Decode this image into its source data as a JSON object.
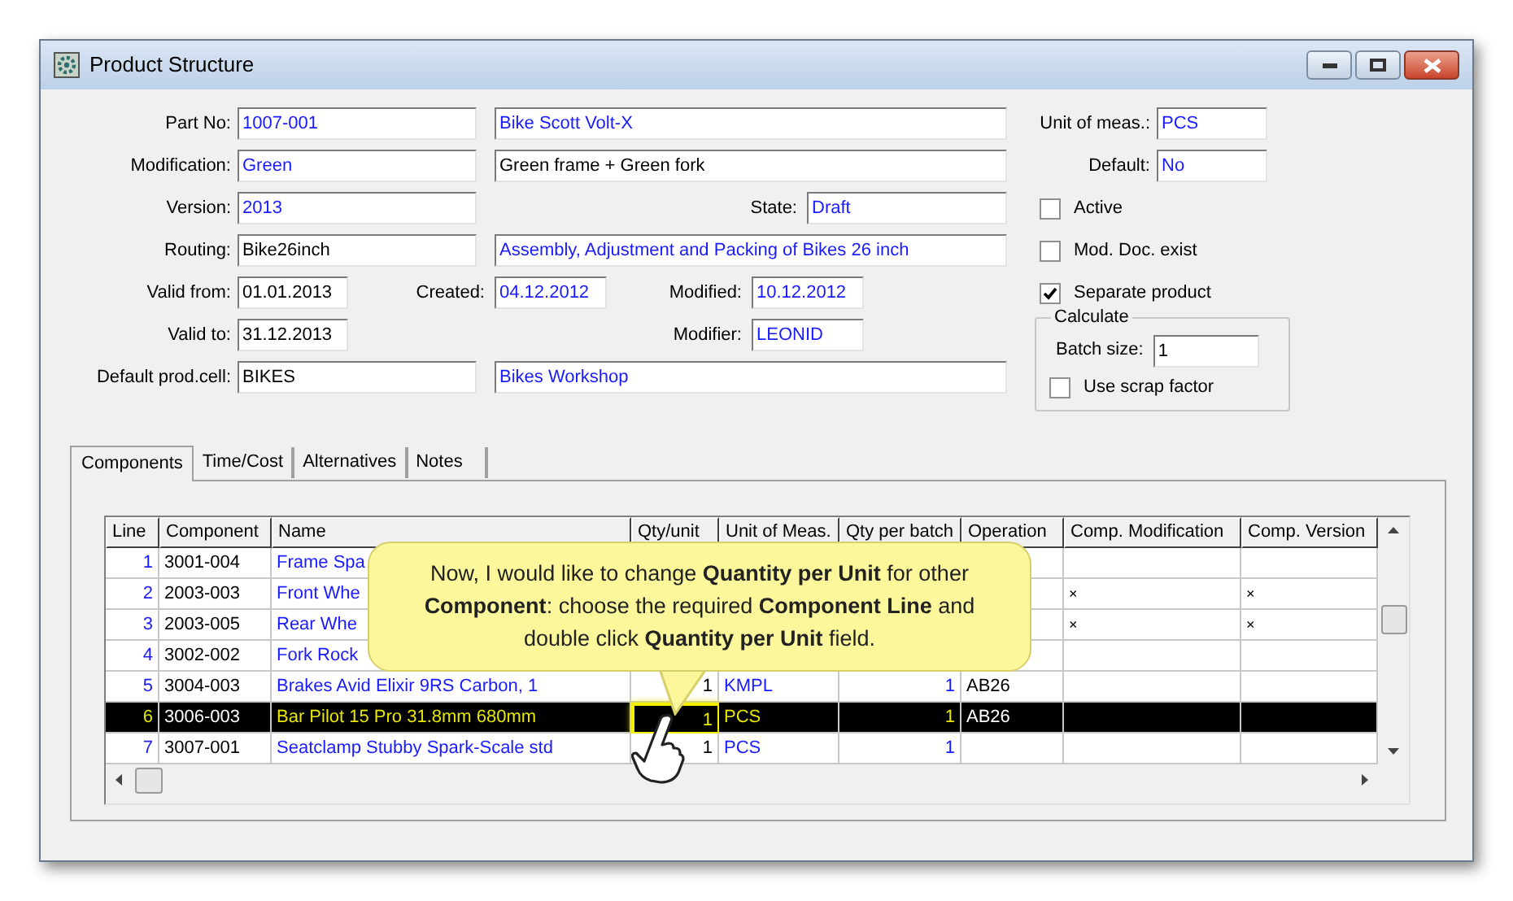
{
  "window": {
    "title": "Product Structure"
  },
  "form": {
    "part_no": {
      "label": "Part No:",
      "value": "1007-001",
      "description": "Bike Scott Volt-X"
    },
    "modification": {
      "label": "Modification:",
      "value": "Green",
      "description": "Green frame + Green fork"
    },
    "version": {
      "label": "Version:",
      "value": "2013"
    },
    "state": {
      "label": "State:",
      "value": "Draft"
    },
    "routing": {
      "label": "Routing:",
      "value": "Bike26inch",
      "description": "Assembly, Adjustment and Packing of Bikes 26 inch"
    },
    "valid_from": {
      "label": "Valid from:",
      "value": "01.01.2013"
    },
    "created": {
      "label": "Created:",
      "value": "04.12.2012"
    },
    "modified": {
      "label": "Modified:",
      "value": "10.12.2012"
    },
    "valid_to": {
      "label": "Valid to:",
      "value": "31.12.2013"
    },
    "modifier": {
      "label": "Modifier:",
      "value": "LEONID"
    },
    "default_prod_cell": {
      "label": "Default prod.cell:",
      "value": "BIKES",
      "description": "Bikes Workshop"
    },
    "unit_of_meas": {
      "label": "Unit of meas.:",
      "value": "PCS"
    },
    "default": {
      "label": "Default:",
      "value": "No"
    },
    "checkboxes": [
      {
        "label": "Active",
        "checked": false
      },
      {
        "label": "Mod. Doc. exist",
        "checked": false
      },
      {
        "label": "Separate product",
        "checked": true
      }
    ],
    "calculate": {
      "title": "Calculate",
      "batch_size": {
        "label": "Batch size:",
        "value": "1"
      },
      "use_scrap_factor": {
        "label": "Use scrap factor",
        "checked": false
      }
    }
  },
  "tabs": [
    {
      "label": "Components",
      "selected": true
    },
    {
      "label": "Time/Cost",
      "selected": false
    },
    {
      "label": "Alternatives",
      "selected": false
    },
    {
      "label": "Notes",
      "selected": false
    }
  ],
  "table": {
    "columns": [
      "Line",
      "Component",
      "Name",
      "Qty/unit",
      "Unit of Meas.",
      "Qty per batch",
      "Operation",
      "Comp. Modification",
      "Comp. Version"
    ],
    "rows": [
      {
        "line": "1",
        "component": "3001-004",
        "name": "Frame Spa",
        "selected": false
      },
      {
        "line": "2",
        "component": "2003-003",
        "name": "Front Whe",
        "comp_modification": "×",
        "comp_version": "×",
        "selected": false
      },
      {
        "line": "3",
        "component": "2003-005",
        "name": "Rear Whe",
        "comp_modification": "×",
        "comp_version": "×",
        "selected": false
      },
      {
        "line": "4",
        "component": "3002-002",
        "name": "Fork Rock",
        "selected": false
      },
      {
        "line": "5",
        "component": "3004-003",
        "name": "Brakes Avid Elixir 9RS Carbon, 1",
        "qty_unit": "1",
        "unit": "KMPL",
        "qty_batch": "1",
        "operation": "AB26",
        "selected": false
      },
      {
        "line": "6",
        "component": "3006-003",
        "name": "Bar Pilot 15 Pro 31.8mm 680mm",
        "qty_unit": "1",
        "unit": "PCS",
        "qty_batch": "1",
        "operation": "AB26",
        "selected": true,
        "focused": true
      },
      {
        "line": "7",
        "component": "3007-001",
        "name": "Seatclamp Stubby Spark-Scale std",
        "qty_unit": "1",
        "unit": "PCS",
        "qty_batch": "1",
        "selected": false
      }
    ]
  },
  "callout": {
    "text": "Now, I would like to change **Quantity per Unit** for other **Component**: choose the required **Component Line** and double click **Quantity per Unit** field."
  }
}
